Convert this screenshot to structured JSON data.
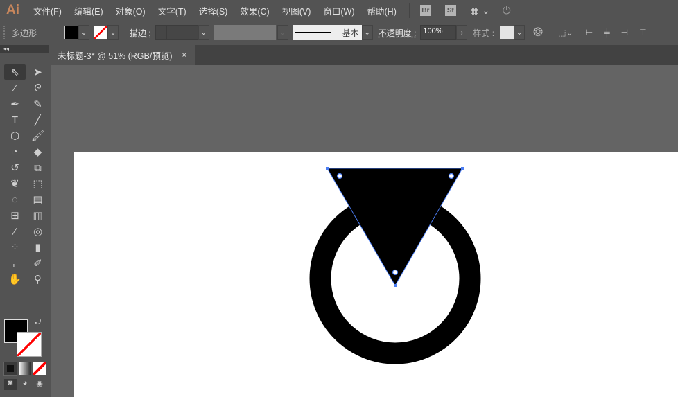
{
  "app": {
    "logo": "Ai"
  },
  "menu": [
    "文件(F)",
    "编辑(E)",
    "对象(O)",
    "文字(T)",
    "选择(S)",
    "效果(C)",
    "视图(V)",
    "窗口(W)",
    "帮助(H)"
  ],
  "bridge": "Br",
  "stock": "St",
  "control": {
    "object_type": "多边形",
    "stroke_label": "描边 :",
    "stroke_profile": "基本",
    "opacity_label": "不透明度 :",
    "opacity_value": "100%",
    "style_label": "样式 :"
  },
  "document_tab": {
    "title": "未标题-3* @ 51% (RGB/预览)",
    "close": "×"
  },
  "colors": {
    "fill": "#000000",
    "stroke": "none",
    "selection": "#4a7cf2"
  }
}
